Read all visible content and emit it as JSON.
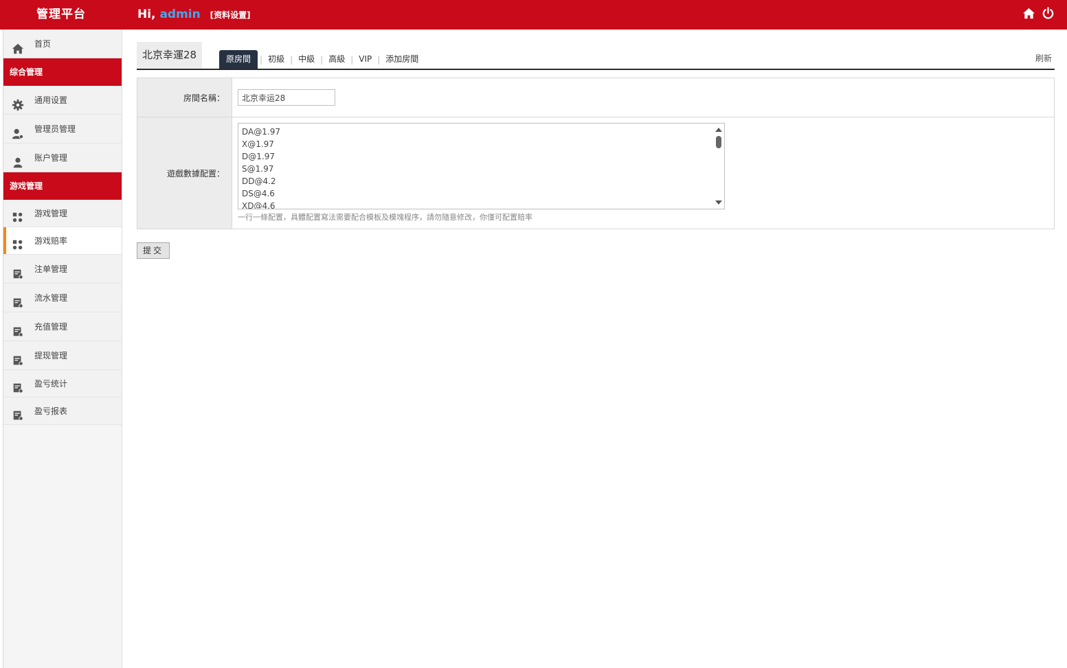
{
  "header": {
    "brand": "管理平台",
    "greeting": "Hi,",
    "username": "admin",
    "profile_link": "[资料设置]",
    "icons": [
      "home-icon",
      "power-icon"
    ]
  },
  "sidebar": {
    "home": "首页",
    "group1": {
      "title": "综合管理",
      "items": [
        "通用设置",
        "管理员管理",
        "账户管理"
      ]
    },
    "group2": {
      "title": "游戏管理",
      "items": [
        "游戏管理",
        "游戏赔率",
        "注单管理",
        "流水管理",
        "充值管理",
        "提现管理",
        "盈亏统计",
        "盈亏报表"
      ]
    }
  },
  "main": {
    "room_title": "北京幸運28",
    "tabs": [
      "原房間",
      "初級",
      "中級",
      "高級",
      "VIP",
      "添加房間"
    ],
    "active_tab": "原房間",
    "refresh": "刷新",
    "form": {
      "name_label": "房間名稱：",
      "name_value": "北京幸运28",
      "config_label": "遊戲數據配置：",
      "config_lines": [
        "DA@1.97",
        "X@1.97",
        "D@1.97",
        "S@1.97",
        "DD@4.2",
        "DS@4.6",
        "XD@4.6"
      ],
      "hint": "一行一條配置，具體配置寫法需要配合模板及模塊程序，請勿隨意修改，你僅可配置賠率"
    },
    "submit": "提交"
  },
  "colors": {
    "header_red": "#c80a1a",
    "active_tab": "#263142",
    "active_marker": "#f08a1c",
    "username_blue": "#4aa3ea"
  }
}
